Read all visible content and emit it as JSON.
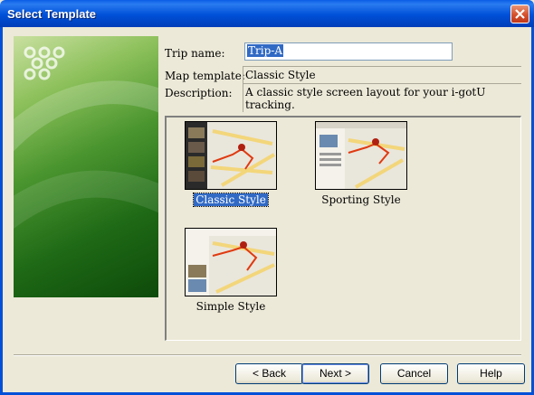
{
  "window": {
    "title": "Select Template"
  },
  "form": {
    "trip_name_label": "Trip name:",
    "trip_name_value": "Trip-A",
    "map_template_label": "Map template:",
    "map_template_value": "Classic Style",
    "description_label": "Description:",
    "description_value": "A classic style screen layout for your i-gotU tracking."
  },
  "templates": [
    {
      "label": "Classic Style",
      "selected": true
    },
    {
      "label": "Sporting Style",
      "selected": false
    },
    {
      "label": "Simple Style",
      "selected": false
    }
  ],
  "buttons": {
    "back": "< Back",
    "next": "Next >",
    "cancel": "Cancel",
    "help": "Help"
  },
  "colors": {
    "titlebar": "#0050d8",
    "selection": "#316ac5",
    "close": "#d4512c",
    "banner_green": "#1f6a16",
    "route": "#e03a10"
  }
}
